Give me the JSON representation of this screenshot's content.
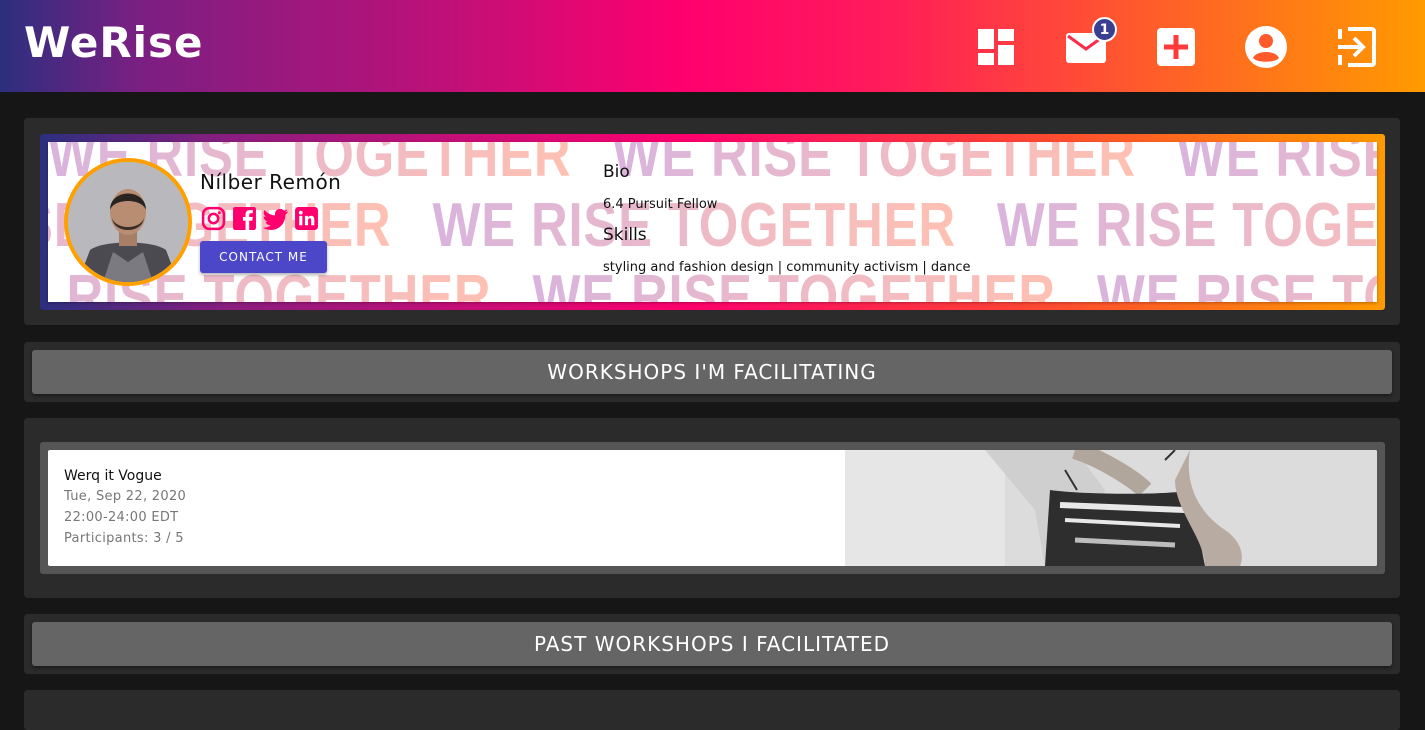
{
  "app": {
    "logo": "WeRise",
    "nav": {
      "dashboard_icon": "dashboard-icon",
      "messages_icon": "mail-icon",
      "messages_badge": "1",
      "add_icon": "add-box-icon",
      "profile_icon": "account-circle-icon",
      "logout_icon": "logout-icon"
    },
    "colors": {
      "accent_pink": "#ff006e",
      "accent_orange": "#ff9a00",
      "accent_purple": "#4b47c8",
      "avatar_ring": "#ffa000"
    }
  },
  "profile": {
    "name": "Nílber Remón",
    "watermark": "WE RISE TOGETHER",
    "socials": [
      "instagram-icon",
      "facebook-icon",
      "twitter-icon",
      "linkedin-icon"
    ],
    "contact_label": "CONTACT ME",
    "bio_heading": "Bio",
    "bio_text": "6.4 Pursuit Fellow",
    "skills_heading": "Skills",
    "skills_text": "styling and fashion design | community activism | dance"
  },
  "sections": {
    "facilitating_title": "WORKSHOPS I'M FACILITATING",
    "past_title": "PAST WORKSHOPS I FACILITATED"
  },
  "workshops": [
    {
      "title": "Werq it Vogue",
      "date": "Tue, Sep 22, 2020",
      "time": "22:00-24:00 EDT",
      "participants": "Participants: 3 / 5"
    }
  ]
}
